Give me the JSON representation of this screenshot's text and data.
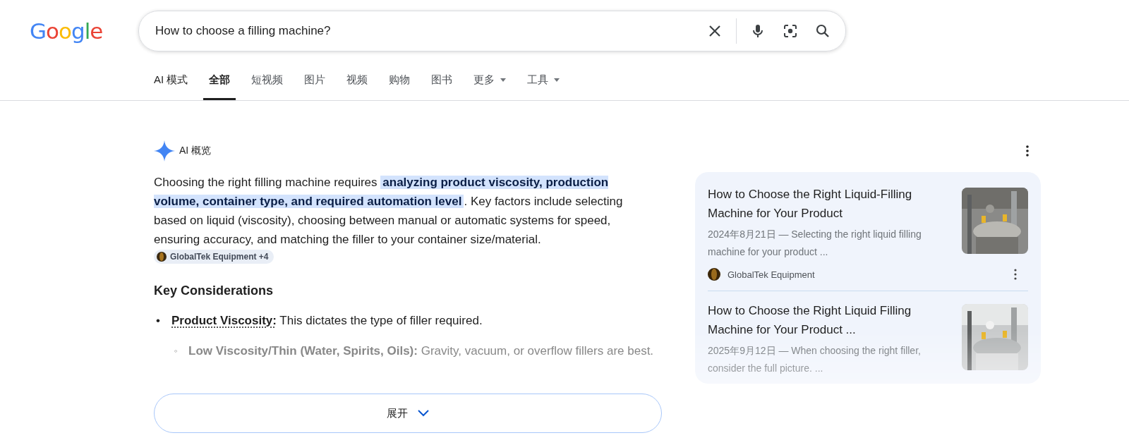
{
  "logo": {
    "letters": [
      {
        "char": "G",
        "color": "#4285f4"
      },
      {
        "char": "o",
        "color": "#ea4335"
      },
      {
        "char": "o",
        "color": "#fbbc05"
      },
      {
        "char": "g",
        "color": "#4285f4"
      },
      {
        "char": "l",
        "color": "#34a853"
      },
      {
        "char": "e",
        "color": "#ea4335"
      }
    ]
  },
  "search": {
    "value": "How to choose a filling machine?"
  },
  "tabs": [
    {
      "label": "AI 模式",
      "selected": false,
      "kind": "plain"
    },
    {
      "label": "全部",
      "selected": true,
      "kind": "plain"
    },
    {
      "label": "短视频",
      "selected": false,
      "kind": "plain"
    },
    {
      "label": "图片",
      "selected": false,
      "kind": "plain"
    },
    {
      "label": "视频",
      "selected": false,
      "kind": "plain"
    },
    {
      "label": "购物",
      "selected": false,
      "kind": "plain"
    },
    {
      "label": "图书",
      "selected": false,
      "kind": "plain"
    },
    {
      "label": "更多",
      "selected": false,
      "kind": "menu"
    },
    {
      "label": "工具",
      "selected": false,
      "kind": "menu"
    }
  ],
  "overview": {
    "title": "AI 概览",
    "summary": "Choosing the right filling machine requires **analyzing product viscosity, production volume, container type, and required automation level**. Key factors include selecting based on liquid (viscosity), choosing between manual or automatic systems for speed, ensuring accuracy, and matching the filler to your container size/material.",
    "citation": "GlobalTek Equipment +4",
    "heading": "Key Considerations",
    "points": [
      {
        "marker": "•",
        "term": "Product Viscosity:",
        "text": "This dictates the type of filler required.",
        "children": [
          {
            "marker": "◦",
            "term": "Low Viscosity/Thin (Water, Spirits, Oils):",
            "text": "Gravity, vacuum, or overflow fillers are best."
          }
        ]
      }
    ],
    "expand": "展开"
  },
  "sources": [
    {
      "title": "How to Choose the Right Liquid-Filling Machine for Your Product",
      "snippet": "2024年8月21日 — Selecting the right liquid filling machine for your product ...",
      "site": "GlobalTek Equipment"
    },
    {
      "title": "How to Choose the Right Liquid Filling Machine for Your Product ...",
      "snippet": "2025年9月12日 — When choosing the right filler, consider the full picture. ..."
    }
  ]
}
